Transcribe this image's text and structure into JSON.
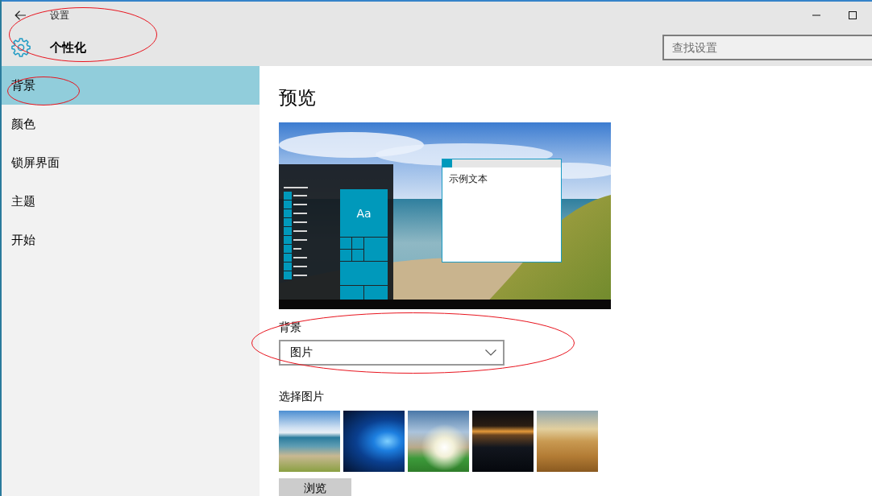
{
  "window": {
    "title": "设置"
  },
  "header": {
    "title": "个性化",
    "circled": true
  },
  "search": {
    "placeholder": "查找设置"
  },
  "sidebar": {
    "items": [
      {
        "label": "背景",
        "selected": true,
        "circled": true
      },
      {
        "label": "颜色",
        "selected": false,
        "circled": false
      },
      {
        "label": "锁屏界面",
        "selected": false,
        "circled": false
      },
      {
        "label": "主题",
        "selected": false,
        "circled": false
      },
      {
        "label": "开始",
        "selected": false,
        "circled": false
      }
    ]
  },
  "content": {
    "heading": "预览",
    "preview": {
      "tile_label": "Aa",
      "sample_text": "示例文本"
    },
    "background": {
      "label": "背景",
      "value": "图片",
      "circled": true
    },
    "picture_picker": {
      "label": "选择图片",
      "thumbnails": [
        {
          "kind": "coast",
          "selected": false
        },
        {
          "kind": "windows",
          "selected": false
        },
        {
          "kind": "sunlit-cliffs",
          "selected": false
        },
        {
          "kind": "dawn-horizon",
          "selected": false
        },
        {
          "kind": "desert-dunes",
          "selected": false
        }
      ],
      "browse_button": "浏览"
    }
  }
}
